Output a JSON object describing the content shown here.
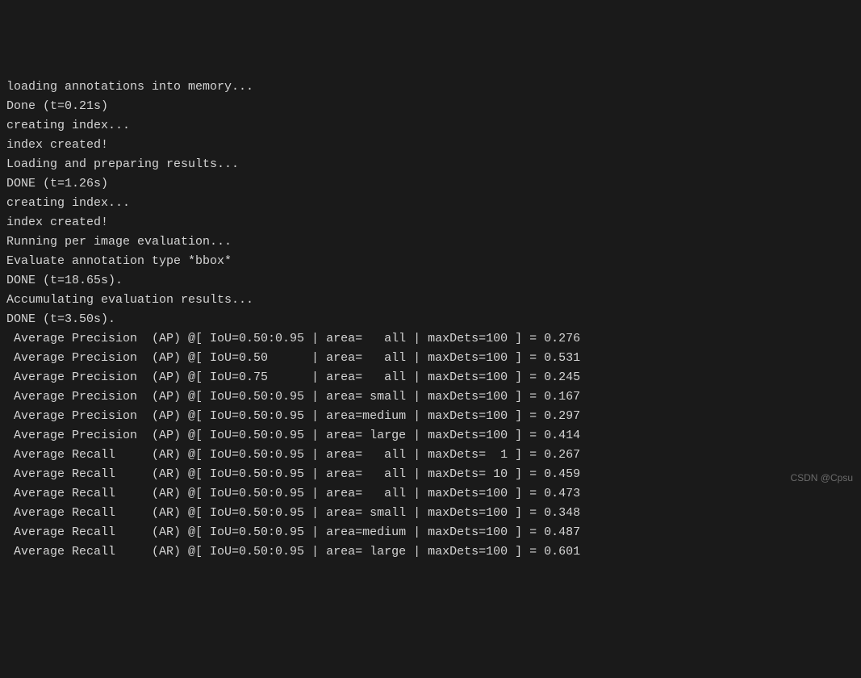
{
  "log_lines": [
    "loading annotations into memory...",
    "Done (t=0.21s)",
    "creating index...",
    "index created!",
    "Loading and preparing results...",
    "DONE (t=1.26s)",
    "creating index...",
    "index created!",
    "Running per image evaluation...",
    "Evaluate annotation type *bbox*",
    "DONE (t=18.65s).",
    "Accumulating evaluation results...",
    "DONE (t=3.50s)."
  ],
  "metrics": [
    {
      "metric": "Average Precision",
      "abbr": "(AP)",
      "iou": "IoU=0.50:0.95",
      "area": "   all",
      "maxdets": "maxDets=100",
      "value": "0.276"
    },
    {
      "metric": "Average Precision",
      "abbr": "(AP)",
      "iou": "IoU=0.50     ",
      "area": "   all",
      "maxdets": "maxDets=100",
      "value": "0.531"
    },
    {
      "metric": "Average Precision",
      "abbr": "(AP)",
      "iou": "IoU=0.75     ",
      "area": "   all",
      "maxdets": "maxDets=100",
      "value": "0.245"
    },
    {
      "metric": "Average Precision",
      "abbr": "(AP)",
      "iou": "IoU=0.50:0.95",
      "area": " small",
      "maxdets": "maxDets=100",
      "value": "0.167"
    },
    {
      "metric": "Average Precision",
      "abbr": "(AP)",
      "iou": "IoU=0.50:0.95",
      "area": "medium",
      "maxdets": "maxDets=100",
      "value": "0.297"
    },
    {
      "metric": "Average Precision",
      "abbr": "(AP)",
      "iou": "IoU=0.50:0.95",
      "area": " large",
      "maxdets": "maxDets=100",
      "value": "0.414"
    },
    {
      "metric": "Average Recall   ",
      "abbr": "(AR)",
      "iou": "IoU=0.50:0.95",
      "area": "   all",
      "maxdets": "maxDets=  1",
      "value": "0.267"
    },
    {
      "metric": "Average Recall   ",
      "abbr": "(AR)",
      "iou": "IoU=0.50:0.95",
      "area": "   all",
      "maxdets": "maxDets= 10",
      "value": "0.459"
    },
    {
      "metric": "Average Recall   ",
      "abbr": "(AR)",
      "iou": "IoU=0.50:0.95",
      "area": "   all",
      "maxdets": "maxDets=100",
      "value": "0.473"
    },
    {
      "metric": "Average Recall   ",
      "abbr": "(AR)",
      "iou": "IoU=0.50:0.95",
      "area": " small",
      "maxdets": "maxDets=100",
      "value": "0.348"
    },
    {
      "metric": "Average Recall   ",
      "abbr": "(AR)",
      "iou": "IoU=0.50:0.95",
      "area": "medium",
      "maxdets": "maxDets=100",
      "value": "0.487"
    },
    {
      "metric": "Average Recall   ",
      "abbr": "(AR)",
      "iou": "IoU=0.50:0.95",
      "area": " large",
      "maxdets": "maxDets=100",
      "value": "0.601"
    }
  ],
  "watermark": "CSDN @Cpsu"
}
